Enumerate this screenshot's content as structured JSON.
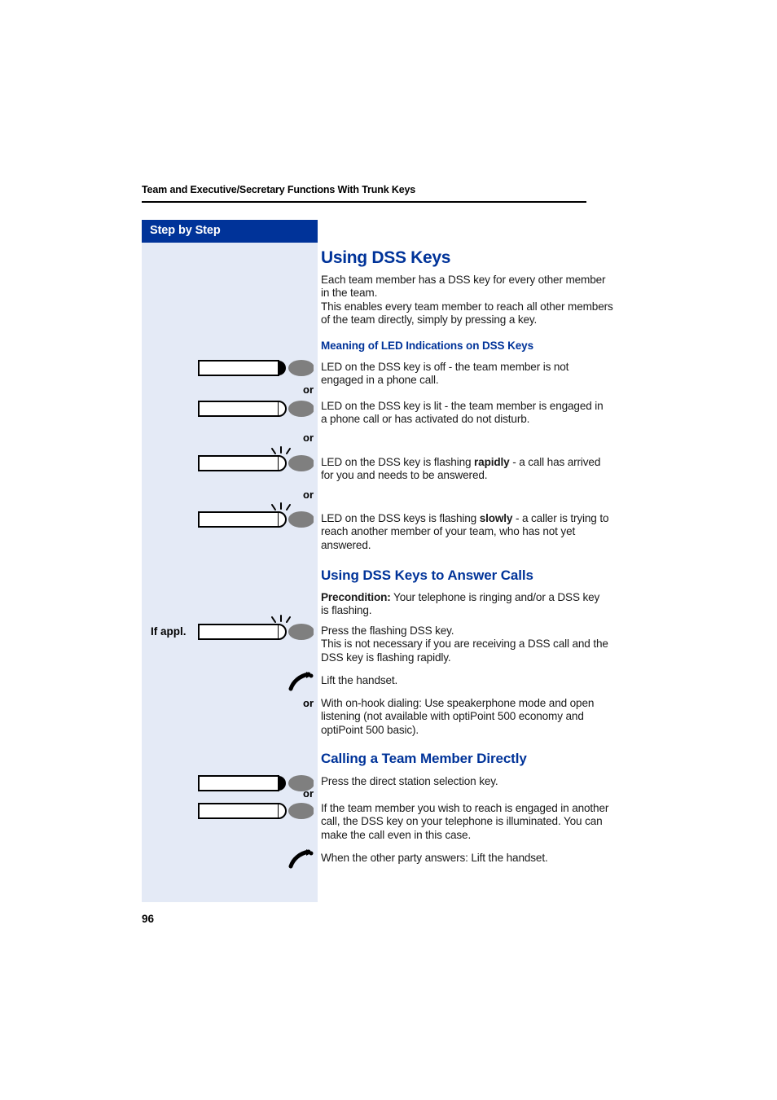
{
  "document": {
    "running_header": "Team and Executive/Secretary Functions With Trunk Keys",
    "page_number": "96"
  },
  "sidebar": {
    "title": "Step by Step",
    "markers": {
      "or": "or",
      "if_applicable": "If appl."
    },
    "icons": [
      {
        "name": "dss-key-led-off",
        "led": "off",
        "label": ""
      },
      {
        "name": "dss-key-led-lit",
        "led": "lit",
        "label": ""
      },
      {
        "name": "dss-key-led-flashing-rapidly",
        "led": "flashing",
        "label": ""
      },
      {
        "name": "dss-key-led-flashing-slowly",
        "led": "flashing",
        "label": ""
      },
      {
        "name": "dss-key-led-flashing",
        "led": "flashing",
        "label": ""
      },
      {
        "name": "handset-lift-icon",
        "led": "",
        "label": ""
      },
      {
        "name": "dss-key-led-off",
        "led": "off",
        "label": ""
      },
      {
        "name": "dss-key-led-lit",
        "led": "lit",
        "label": ""
      },
      {
        "name": "handset-lift-icon",
        "led": "",
        "label": ""
      }
    ]
  },
  "main": {
    "heading": "Using DSS Keys",
    "intro": "Each team member has a DSS key for every other member in the team.\nThis enables every team member to reach all other members of the team directly, simply by pressing a key.",
    "sections": [
      {
        "heading": "Meaning of LED Indications on DSS Keys",
        "items": [
          {
            "text_before": "LED on the DSS key is off - the team member is not engaged in a phone call.",
            "emphasis": "",
            "text_after": ""
          },
          {
            "text_before": "LED on the DSS key is lit - the team member is engaged in a phone call or has activated do not disturb.",
            "emphasis": "",
            "text_after": ""
          },
          {
            "text_before": "LED on the DSS key is flashing ",
            "emphasis": "rapidly",
            "text_after": " - a call has arrived for you and needs to be answered."
          },
          {
            "text_before": "LED on the DSS keys is flashing ",
            "emphasis": "slowly",
            "text_after": " - a caller is trying to reach another member of your team, who has not yet answered."
          }
        ]
      },
      {
        "heading": "Using DSS Keys to Answer Calls",
        "precondition_label": "Precondition:",
        "precondition_text": " Your telephone is ringing and/or a DSS key is flashing.",
        "steps": [
          "Press the flashing DSS key.\nThis is not necessary if you are receiving a DSS call and the DSS key is flashing rapidly.",
          "Lift the handset.",
          "With on-hook dialing: Use speakerphone mode and open listening (not available with optiPoint 500 economy and optiPoint 500 basic)."
        ]
      },
      {
        "heading": "Calling a Team Member Directly",
        "steps": [
          "Press the direct station selection key.",
          "If the team member you wish to reach is engaged in another call, the DSS key on your telephone is illuminated. You can make the call even in this case.",
          "When the other party answers: Lift the handset."
        ]
      }
    ]
  },
  "colors": {
    "accent_blue": "#003399",
    "sidebar_bg": "#e4eaf6",
    "led_gray": "#7f7f7f",
    "text": "#1a1a1a"
  }
}
